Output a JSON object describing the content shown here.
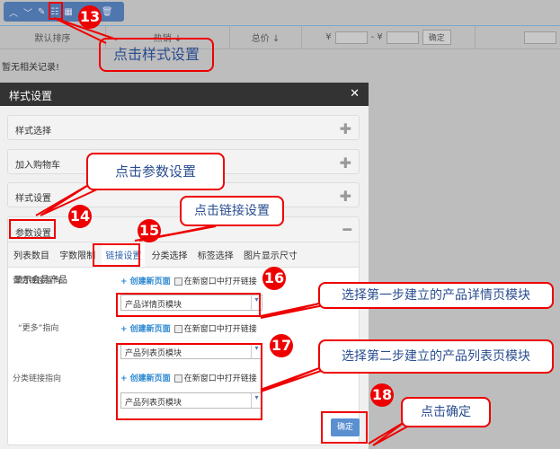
{
  "toolbar": {
    "icons": [
      "chevron-up",
      "chevron-down",
      "edit",
      "style-settings",
      "table",
      "delete"
    ]
  },
  "sortbar": {
    "default": "默认排序",
    "hot": "热销 ↓",
    "total": "总价 ↓",
    "yen1": "¥",
    "dash": "- ¥",
    "confirm": "确定"
  },
  "empty_text": "暂无相关记录!",
  "dialog": {
    "title": "样式设置",
    "close": "✕",
    "panels": [
      "样式选择",
      "加入购物车",
      "样式设置",
      "参数设置"
    ],
    "tabs": [
      "列表数目",
      "字数限制",
      "链接设置",
      "分类选择",
      "标签选择",
      "图片显示尺寸",
      "显示会员产品"
    ],
    "rows": [
      {
        "label": "详情链接指向",
        "create": "+ 创建新页面",
        "newwin": "在新窗口中打开链接",
        "select": "产品详情页模块"
      },
      {
        "label": "“更多”指向",
        "create": "+ 创建新页面",
        "newwin": "在新窗口中打开链接",
        "select": "产品列表页模块"
      },
      {
        "label": "分类链接指向",
        "create": "+ 创建新页面",
        "newwin": "在新窗口中打开链接",
        "select": "产品列表页模块"
      }
    ],
    "ok": "确定"
  },
  "annotations": {
    "c13": "点击样式设置",
    "c14": "点击参数设置",
    "c15": "点击链接设置",
    "c16": "选择第一步建立的产品详情页模块",
    "c17": "选择第二步建立的产品列表页模块",
    "c18": "点击确定",
    "n13": "13",
    "n14": "14",
    "n15": "15",
    "n16": "16",
    "n17": "17",
    "n18": "18"
  }
}
